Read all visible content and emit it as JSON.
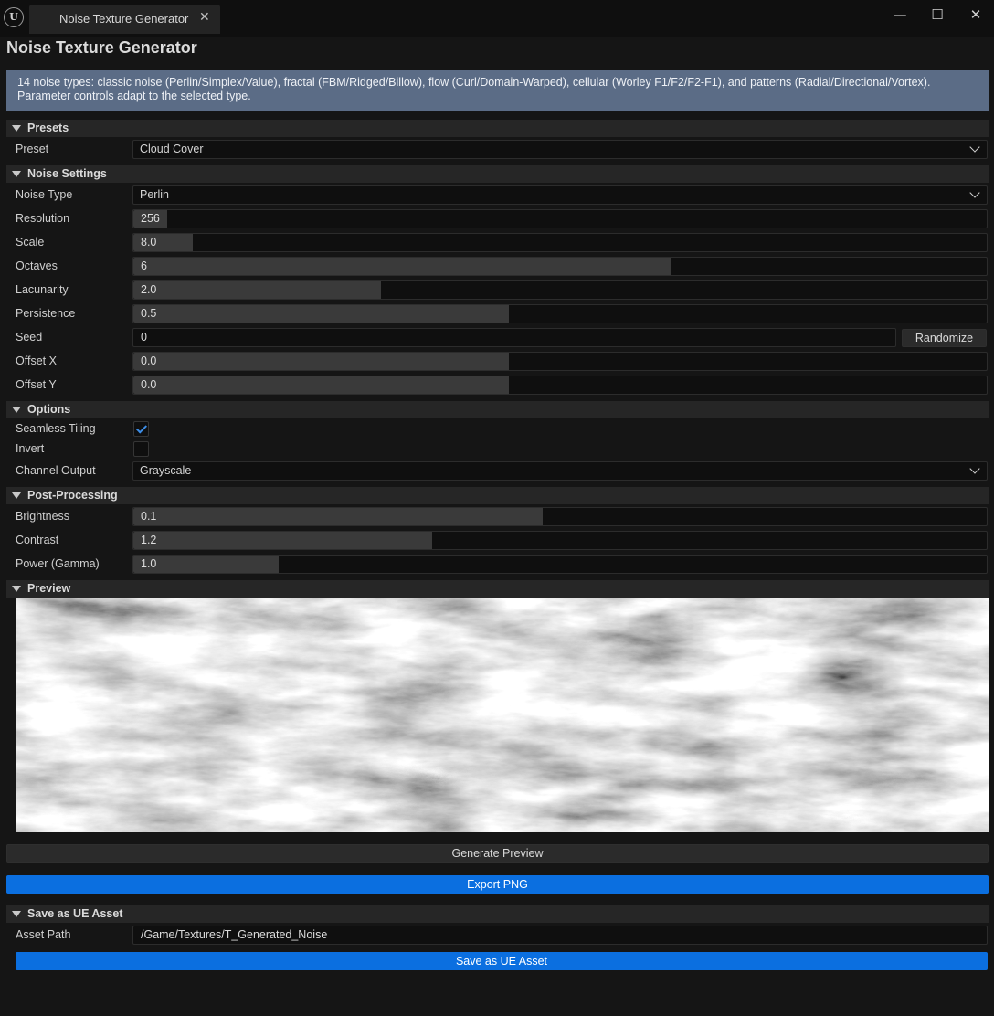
{
  "window": {
    "tab_title": "Noise Texture Generator",
    "logo_text": "U",
    "close_glyph": "✕",
    "minimize_glyph": "—",
    "maximize_glyph": "☐",
    "window_close_glyph": "✕"
  },
  "page": {
    "title": "Noise Texture Generator",
    "info": "14 noise types: classic noise (Perlin/Simplex/Value), fractal (FBM/Ridged/Billow), flow (Curl/Domain-Warped), cellular (Worley F1/F2/F2-F1), and patterns (Radial/Directional/Vortex). Parameter controls adapt to the selected type."
  },
  "presets": {
    "section_title": "Presets",
    "preset_label": "Preset",
    "preset_value": "Cloud Cover"
  },
  "noise_settings": {
    "section_title": "Noise Settings",
    "noise_type_label": "Noise Type",
    "noise_type_value": "Perlin",
    "resolution": {
      "label": "Resolution",
      "value": "256",
      "fill": 0.04
    },
    "scale": {
      "label": "Scale",
      "value": "8.0",
      "fill": 0.07
    },
    "octaves": {
      "label": "Octaves",
      "value": "6",
      "fill": 0.63
    },
    "lacunarity": {
      "label": "Lacunarity",
      "value": "2.0",
      "fill": 0.29
    },
    "persistence": {
      "label": "Persistence",
      "value": "0.5",
      "fill": 0.44
    },
    "seed": {
      "label": "Seed",
      "value": "0"
    },
    "randomize_label": "Randomize",
    "offset_x": {
      "label": "Offset X",
      "value": "0.0",
      "fill": 0.44
    },
    "offset_y": {
      "label": "Offset Y",
      "value": "0.0",
      "fill": 0.44
    }
  },
  "options": {
    "section_title": "Options",
    "seamless_label": "Seamless Tiling",
    "seamless_checked": true,
    "invert_label": "Invert",
    "invert_checked": false,
    "channel_label": "Channel Output",
    "channel_value": "Grayscale"
  },
  "post": {
    "section_title": "Post-Processing",
    "brightness": {
      "label": "Brightness",
      "value": "0.1",
      "fill": 0.48
    },
    "contrast": {
      "label": "Contrast",
      "value": "1.2",
      "fill": 0.35
    },
    "power": {
      "label": "Power (Gamma)",
      "value": "1.0",
      "fill": 0.17
    }
  },
  "preview": {
    "section_title": "Preview",
    "generate_label": "Generate Preview",
    "export_label": "Export PNG"
  },
  "save_asset": {
    "section_title": "Save as UE Asset",
    "path_label": "Asset Path",
    "path_value": "/Game/Textures/T_Generated_Noise",
    "save_label": "Save as UE Asset"
  },
  "colors": {
    "accent": "#0b6fe0",
    "banner": "#5b6c86",
    "background": "#151515",
    "field": "#0f0f0f"
  },
  "icons": {
    "logo": "unreal-logo-icon",
    "collapse": "triangle-down-icon",
    "combo": "chevron-down-icon",
    "check": "checkmark-icon"
  }
}
